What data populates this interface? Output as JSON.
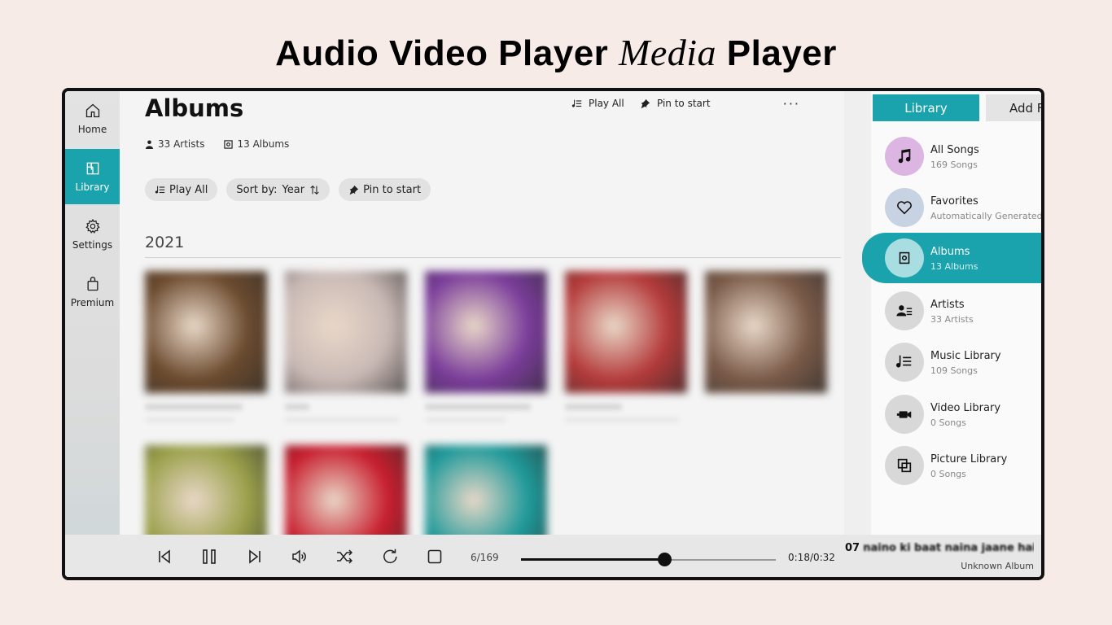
{
  "banner": {
    "part1": "Audio Video Player",
    "part2": "Media",
    "part3": "Player"
  },
  "nav": [
    {
      "label": "Home",
      "icon": "home-icon"
    },
    {
      "label": "Library",
      "icon": "library-icon"
    },
    {
      "label": "Settings",
      "icon": "gear-icon"
    },
    {
      "label": "Premium",
      "icon": "shopping-bag-icon"
    }
  ],
  "header": {
    "title": "Albums",
    "play_all": "Play All",
    "pin": "Pin to start",
    "more": "···"
  },
  "stats": {
    "artists": "33 Artists",
    "albums": "13 Albums"
  },
  "chips": {
    "play_all": "Play All",
    "sort_label": "Sort by:",
    "sort_value": "Year",
    "pin": "Pin to start"
  },
  "group": {
    "year": "2021"
  },
  "album_tile_colors": [
    "#6b4a2e",
    "#c9b9b5",
    "#7a3c9a",
    "#b43a3a",
    "#7a5a48",
    "#9aa04a",
    "#c81e2e",
    "#1f9a9a"
  ],
  "right_panel": {
    "library_button": "Library",
    "add_button": "Add Fo",
    "items": [
      {
        "title": "All Songs",
        "sub": "169 Songs",
        "icon": "music-note-icon"
      },
      {
        "title": "Favorites",
        "sub": "Automatically Generated",
        "icon": "heart-icon"
      },
      {
        "title": "Albums",
        "sub": "13 Albums",
        "icon": "album-icon"
      },
      {
        "title": "Artists",
        "sub": "33 Artists",
        "icon": "artist-icon"
      },
      {
        "title": "Music Library",
        "sub": "109 Songs",
        "icon": "music-list-icon"
      },
      {
        "title": "Video Library",
        "sub": "0 Songs",
        "icon": "video-camera-icon"
      },
      {
        "title": "Picture Library",
        "sub": "0 Songs",
        "icon": "picture-icon"
      }
    ]
  },
  "player": {
    "counter": "6/169",
    "time": "0:18/0:32",
    "progress_fraction": 0.5625,
    "track_number": "07",
    "track_title": "naino ki baat naina jaane hai",
    "album": "Unknown Album"
  },
  "colors": {
    "accent": "#1aa3ad",
    "background": "#f7ebe7"
  }
}
